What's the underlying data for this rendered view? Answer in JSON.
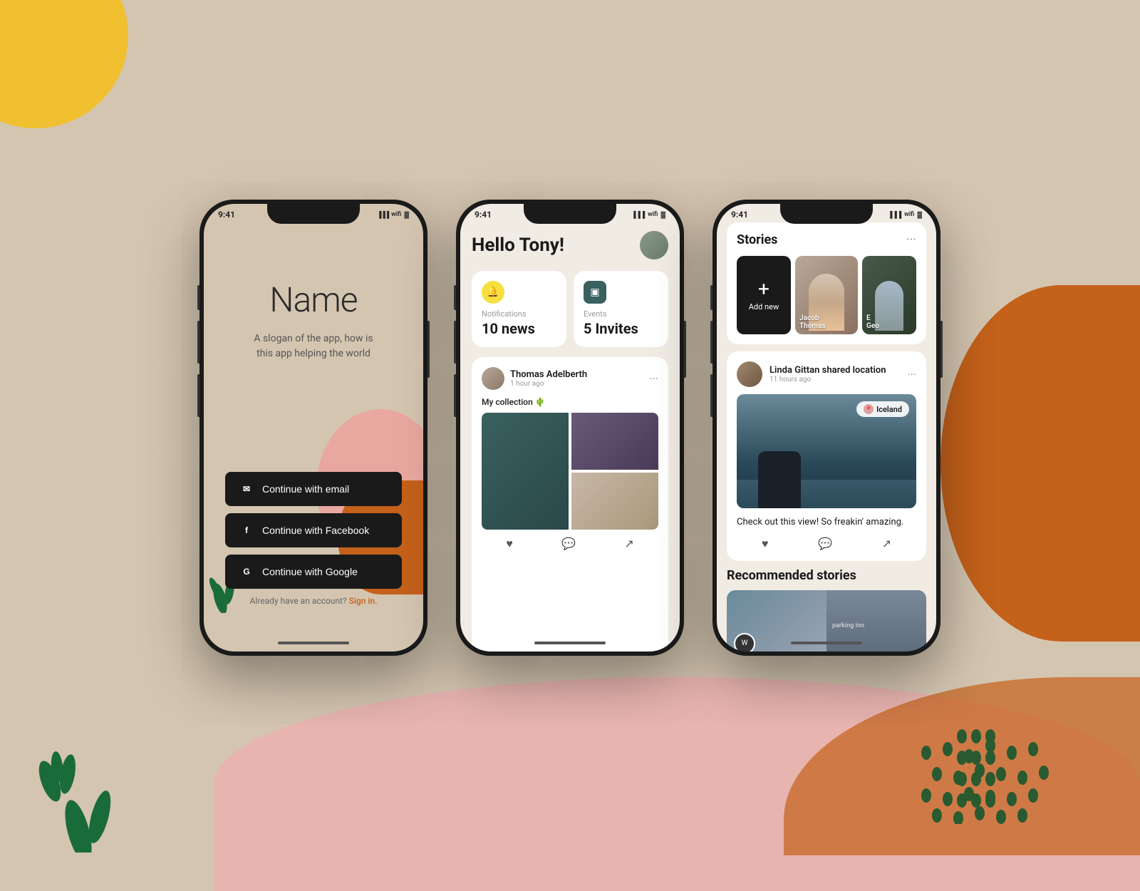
{
  "background": {
    "color": "#d4c5b0"
  },
  "phone1": {
    "status_time": "9:41",
    "title": "Name",
    "slogan": "A slogan of the app, how is\nthis app helping the world",
    "btn_email": "Continue with email",
    "btn_facebook": "Continue with Facebook",
    "btn_google": "Continue with Google",
    "signin_text": "Already have an account?",
    "signin_link": "Sign in."
  },
  "phone2": {
    "status_time": "9:41",
    "greeting": "Hello Tony!",
    "notifications_label": "Notifications",
    "notifications_value": "10 news",
    "events_label": "Events",
    "events_value": "5 Invites",
    "post_author": "Thomas Adelberth",
    "post_time": "1 hour ago",
    "post_title": "My collection 🌵"
  },
  "phone3": {
    "status_time": "9:41",
    "stories_title": "Stories",
    "story_add_label": "Add new",
    "story_jacob": "Jacob\nThomas",
    "story_geo": "E\nGeo",
    "post_author": "Linda Gittan shared location",
    "post_time": "11 hours ago",
    "iceland_label": "Iceland",
    "post_text": "Check out this view! So freakin' amazing.",
    "recommended_title": "Recommended stories"
  }
}
